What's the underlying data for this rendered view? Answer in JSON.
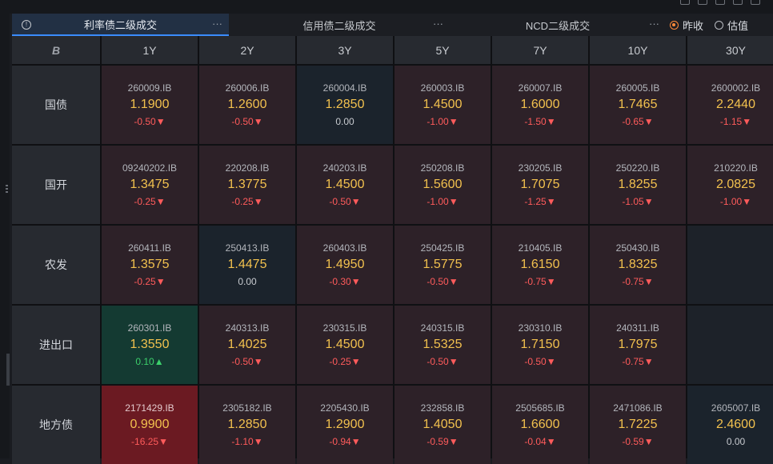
{
  "tabs": [
    {
      "label": "利率债二级成交",
      "active": true
    },
    {
      "label": "信用债二级成交",
      "active": false
    },
    {
      "label": "NCD二级成交",
      "active": false
    }
  ],
  "more_label": "···",
  "info_glyph": "!",
  "radios": [
    {
      "label": "昨收",
      "checked": true
    },
    {
      "label": "估值",
      "checked": false
    }
  ],
  "logo_glyph": "B",
  "columns": [
    "1Y",
    "2Y",
    "3Y",
    "5Y",
    "7Y",
    "10Y",
    "30Y"
  ],
  "rows": [
    {
      "label": "国债",
      "cells": [
        {
          "code": "260009.IB",
          "yield": "1.1900",
          "change": "-0.50▼",
          "dir": "down"
        },
        {
          "code": "260006.IB",
          "yield": "1.2600",
          "change": "-0.50▼",
          "dir": "down"
        },
        {
          "code": "260004.IB",
          "yield": "1.2850",
          "change": "0.00",
          "dir": "flat"
        },
        {
          "code": "260003.IB",
          "yield": "1.4500",
          "change": "-1.00▼",
          "dir": "down"
        },
        {
          "code": "260007.IB",
          "yield": "1.6000",
          "change": "-1.50▼",
          "dir": "down"
        },
        {
          "code": "260005.IB",
          "yield": "1.7465",
          "change": "-0.65▼",
          "dir": "down"
        },
        {
          "code": "2600002.IB",
          "yield": "2.2440",
          "change": "-1.15▼",
          "dir": "down"
        }
      ]
    },
    {
      "label": "国开",
      "cells": [
        {
          "code": "09240202.IB",
          "yield": "1.3475",
          "change": "-0.25▼",
          "dir": "down"
        },
        {
          "code": "220208.IB",
          "yield": "1.3775",
          "change": "-0.25▼",
          "dir": "down"
        },
        {
          "code": "240203.IB",
          "yield": "1.4500",
          "change": "-0.50▼",
          "dir": "down"
        },
        {
          "code": "250208.IB",
          "yield": "1.5600",
          "change": "-1.00▼",
          "dir": "down"
        },
        {
          "code": "230205.IB",
          "yield": "1.7075",
          "change": "-1.25▼",
          "dir": "down"
        },
        {
          "code": "250220.IB",
          "yield": "1.8255",
          "change": "-1.05▼",
          "dir": "down"
        },
        {
          "code": "210220.IB",
          "yield": "2.0825",
          "change": "-1.00▼",
          "dir": "down"
        }
      ]
    },
    {
      "label": "农发",
      "cells": [
        {
          "code": "260411.IB",
          "yield": "1.3575",
          "change": "-0.25▼",
          "dir": "down"
        },
        {
          "code": "250413.IB",
          "yield": "1.4475",
          "change": "0.00",
          "dir": "flat"
        },
        {
          "code": "260403.IB",
          "yield": "1.4950",
          "change": "-0.30▼",
          "dir": "down"
        },
        {
          "code": "250425.IB",
          "yield": "1.5775",
          "change": "-0.50▼",
          "dir": "down"
        },
        {
          "code": "210405.IB",
          "yield": "1.6150",
          "change": "-0.75▼",
          "dir": "down"
        },
        {
          "code": "250430.IB",
          "yield": "1.8325",
          "change": "-0.75▼",
          "dir": "down"
        },
        null
      ]
    },
    {
      "label": "进出口",
      "cells": [
        {
          "code": "260301.IB",
          "yield": "1.3550",
          "change": "0.10▲",
          "dir": "up"
        },
        {
          "code": "240313.IB",
          "yield": "1.4025",
          "change": "-0.50▼",
          "dir": "down"
        },
        {
          "code": "230315.IB",
          "yield": "1.4500",
          "change": "-0.25▼",
          "dir": "down"
        },
        {
          "code": "240315.IB",
          "yield": "1.5325",
          "change": "-0.50▼",
          "dir": "down"
        },
        {
          "code": "230310.IB",
          "yield": "1.7150",
          "change": "-0.50▼",
          "dir": "down"
        },
        {
          "code": "240311.IB",
          "yield": "1.7975",
          "change": "-0.75▼",
          "dir": "down"
        },
        null
      ]
    },
    {
      "label": "地方债",
      "cells": [
        {
          "code": "2171429.IB",
          "yield": "0.9900",
          "change": "-16.25▼",
          "dir": "strong"
        },
        {
          "code": "2305182.IB",
          "yield": "1.2850",
          "change": "-1.10▼",
          "dir": "down"
        },
        {
          "code": "2205430.IB",
          "yield": "1.2900",
          "change": "-0.94▼",
          "dir": "down"
        },
        {
          "code": "232858.IB",
          "yield": "1.4050",
          "change": "-0.59▼",
          "dir": "down"
        },
        {
          "code": "2505685.IB",
          "yield": "1.6600",
          "change": "-0.04▼",
          "dir": "down"
        },
        {
          "code": "2471086.IB",
          "yield": "1.7225",
          "change": "-0.59▼",
          "dir": "down"
        },
        {
          "code": "2605007.IB",
          "yield": "2.4600",
          "change": "0.00",
          "dir": "flat"
        }
      ]
    }
  ],
  "colors": {
    "accent": "#3a8cff",
    "yield_text": "#f2c14e",
    "down": "#ff5b5b",
    "up": "#3cd06b",
    "radio_checked": "#ff8a3a"
  }
}
